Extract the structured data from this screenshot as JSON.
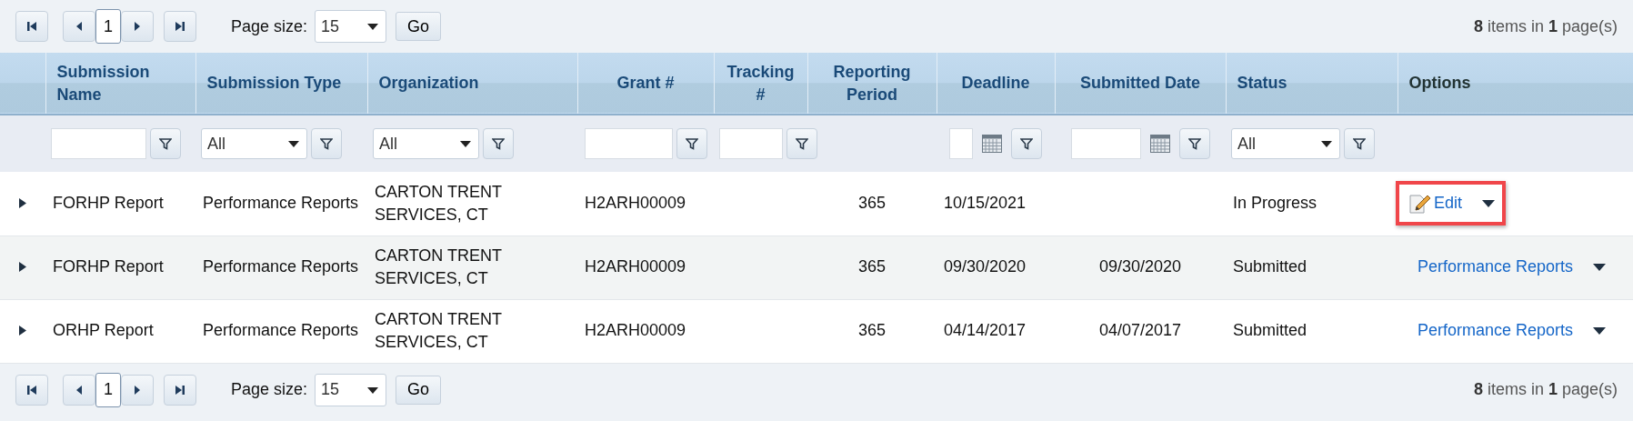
{
  "pager_top": {
    "current_page": "1",
    "page_size_label": "Page size:",
    "page_size": "15",
    "go": "Go",
    "info": "**8** items in **1** page(s)"
  },
  "table": {
    "columns": [
      {
        "label": "Submission Name"
      },
      {
        "label": "Submission Type"
      },
      {
        "label": "Organization"
      },
      {
        "label": "Grant #"
      },
      {
        "label": "Tracking #"
      },
      {
        "label": "Reporting Period"
      },
      {
        "label": "Deadline"
      },
      {
        "label": "Submitted Date"
      },
      {
        "label": "Status"
      },
      {
        "label": "Options"
      }
    ],
    "filters": [
      {
        "kind": "text"
      },
      {
        "kind": "select",
        "value": "All"
      },
      {
        "kind": "select",
        "value": "All"
      },
      {
        "kind": "text"
      },
      {
        "kind": "text"
      },
      {
        "kind": "none"
      },
      {
        "kind": "date"
      },
      {
        "kind": "date"
      },
      {
        "kind": "select",
        "value": "All"
      },
      {
        "kind": "none"
      }
    ],
    "rows": [
      {
        "cells": [
          "FORHP Report",
          "Performance Reports",
          "CARTON TRENT SERVICES, CT",
          "H2ARH00009",
          "",
          "365",
          "10/15/2021",
          "",
          "In Progress"
        ],
        "option": {
          "kind": "edit",
          "label": "Edit",
          "highlighted": true
        }
      },
      {
        "cells": [
          "FORHP Report",
          "Performance Reports",
          "CARTON TRENT SERVICES, CT",
          "H2ARH00009",
          "",
          "365",
          "09/30/2020",
          "09/30/2020",
          "Submitted"
        ],
        "option": {
          "kind": "link",
          "label": "Performance Reports",
          "highlighted": false
        }
      },
      {
        "cells": [
          "ORHP Report",
          "Performance Reports",
          "CARTON TRENT SERVICES, CT",
          "H2ARH00009",
          "",
          "365",
          "04/14/2017",
          "04/07/2017",
          "Submitted"
        ],
        "option": {
          "kind": "link",
          "label": "Performance Reports",
          "highlighted": false
        }
      }
    ]
  },
  "pager_bottom": {
    "current_page": "1",
    "page_size_label": "Page size:",
    "page_size": "15",
    "go": "Go",
    "info": "**8** items in **1** page(s)"
  }
}
